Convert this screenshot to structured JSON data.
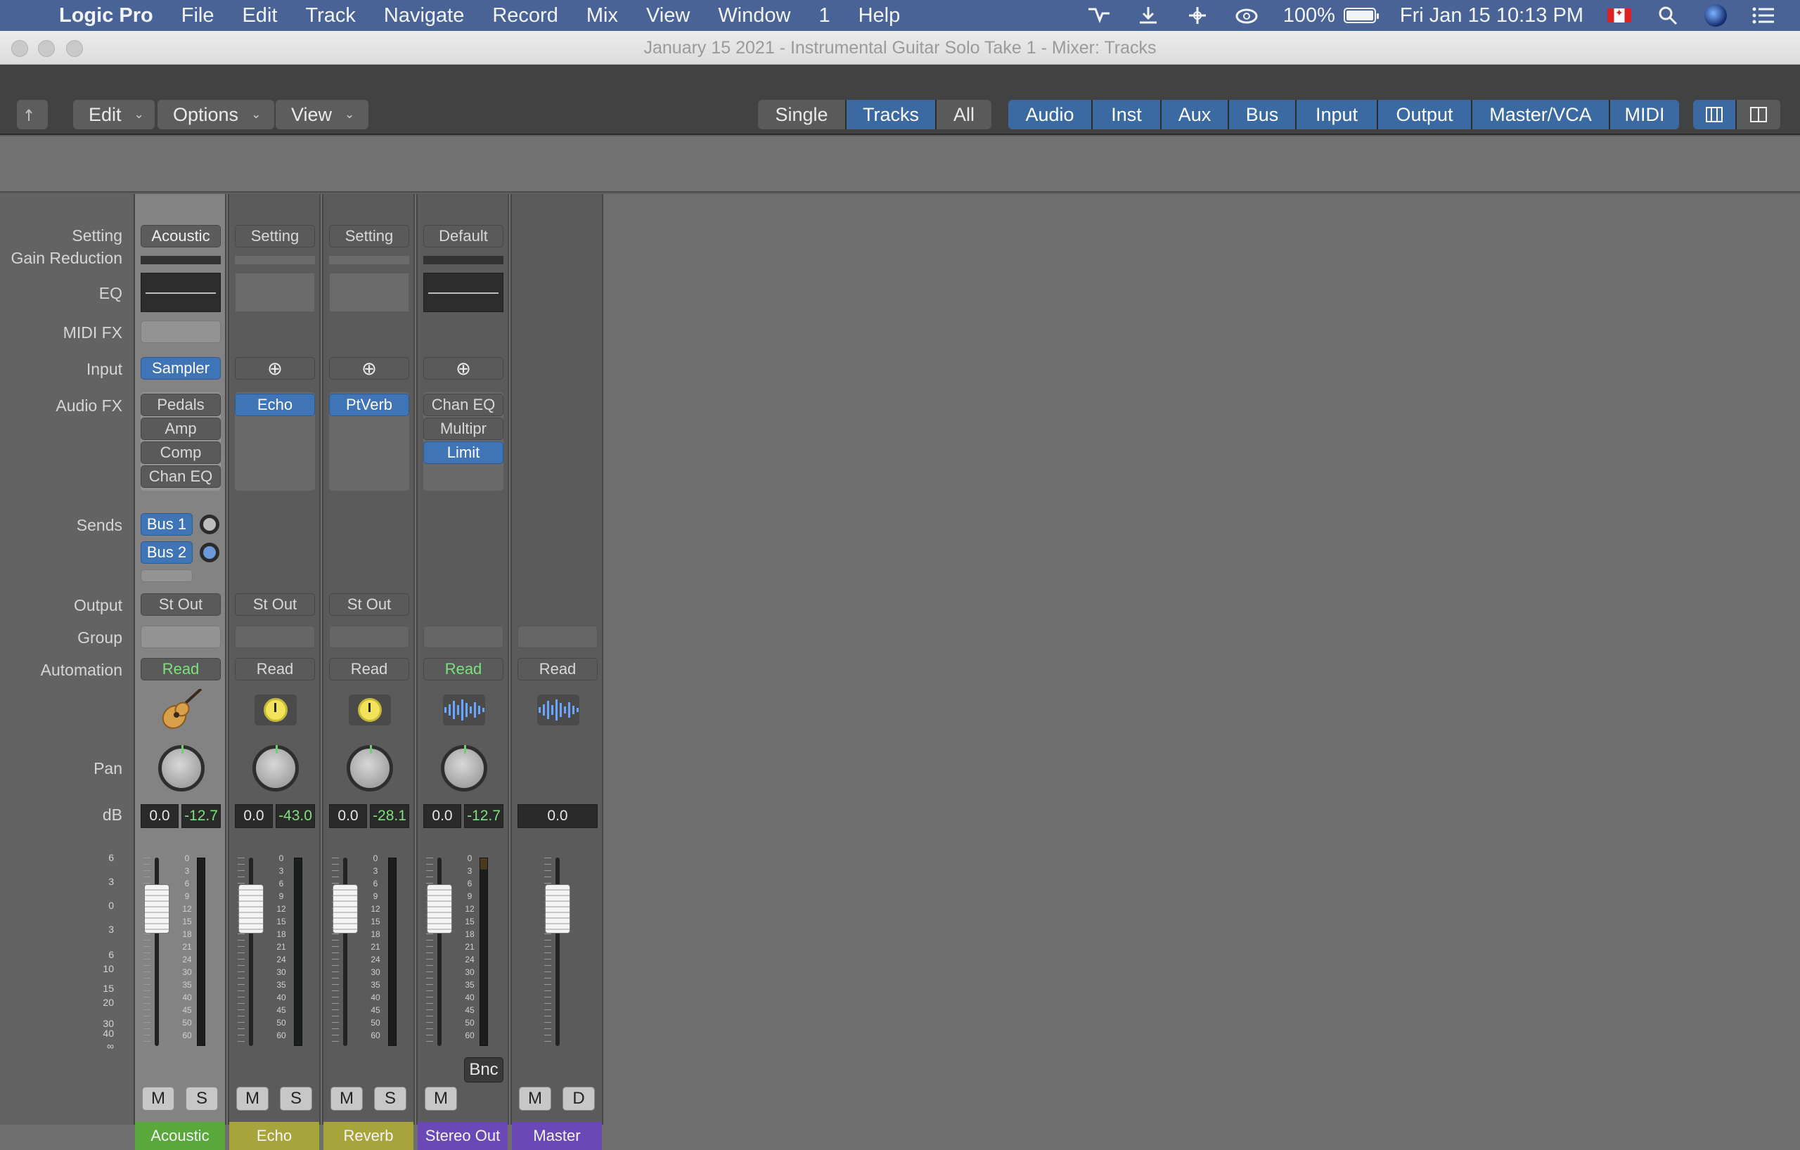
{
  "menubar": {
    "app": "Logic Pro",
    "items": [
      "File",
      "Edit",
      "Track",
      "Navigate",
      "Record",
      "Mix",
      "View",
      "Window",
      "1",
      "Help"
    ],
    "battery": "100%",
    "clock": "Fri Jan 15  10:13 PM"
  },
  "window": {
    "title": "January 15 2021 - Instrumental Guitar Solo Take 1 - Mixer: Tracks"
  },
  "toolbar": {
    "back_icon": "back-arrow-icon",
    "edit": "Edit",
    "options": "Options",
    "view": "View",
    "view_modes": [
      "Single",
      "Tracks",
      "All"
    ],
    "active_view_mode": "Tracks",
    "filters": [
      "Audio",
      "Inst",
      "Aux",
      "Bus",
      "Input",
      "Output",
      "Master/VCA",
      "MIDI"
    ],
    "colors": {
      "blue": "#3b6aa3"
    }
  },
  "row_labels": {
    "setting": "Setting",
    "gain_reduction": "Gain Reduction",
    "eq": "EQ",
    "midi_fx": "MIDI FX",
    "input": "Input",
    "audio_fx": "Audio FX",
    "sends": "Sends",
    "output": "Output",
    "group": "Group",
    "automation": "Automation",
    "pan": "Pan",
    "db": "dB"
  },
  "fader_scale": [
    "6",
    "3",
    "0",
    "3",
    "6",
    "10",
    "15",
    "20",
    "30",
    "40",
    "∞"
  ],
  "meter_scale": [
    "0",
    "3",
    "6",
    "9",
    "12",
    "15",
    "18",
    "21",
    "24",
    "30",
    "35",
    "40",
    "45",
    "50",
    "60"
  ],
  "strips": [
    {
      "name": "Acoustic",
      "color": "#5aa83b",
      "setting": "Acoustic",
      "input": "Sampler",
      "audio_fx": [
        "Pedals",
        "Amp",
        "Comp",
        "Chan EQ"
      ],
      "sends": [
        "Bus 1",
        "Bus 2"
      ],
      "output": "St Out",
      "automation": "Read",
      "volume": "0.0",
      "peak": "-12.7",
      "mute": "M",
      "solo": "S"
    },
    {
      "name": "Echo",
      "color": "#a6a43a",
      "setting": "Setting",
      "input": "link",
      "audio_fx": [
        "Echo"
      ],
      "output": "St Out",
      "automation": "Read",
      "volume": "0.0",
      "peak": "-43.0",
      "mute": "M",
      "solo": "S"
    },
    {
      "name": "Reverb",
      "color": "#a6a43a",
      "setting": "Setting",
      "input": "link",
      "audio_fx": [
        "PtVerb"
      ],
      "output": "St Out",
      "automation": "Read",
      "volume": "0.0",
      "peak": "-28.1",
      "mute": "M",
      "solo": "S"
    },
    {
      "name": "Stereo Out",
      "color": "#6a48b6",
      "setting": "Default",
      "input": "link",
      "audio_fx": [
        "Chan EQ",
        "Multipr",
        "Limit"
      ],
      "automation": "Read",
      "volume": "0.0",
      "peak": "-12.7",
      "mute": "M",
      "bounce": "Bnc"
    },
    {
      "name": "Master",
      "color": "#6a48b6",
      "automation": "Read",
      "volume": "0.0",
      "mute": "M",
      "dim": "D"
    }
  ]
}
